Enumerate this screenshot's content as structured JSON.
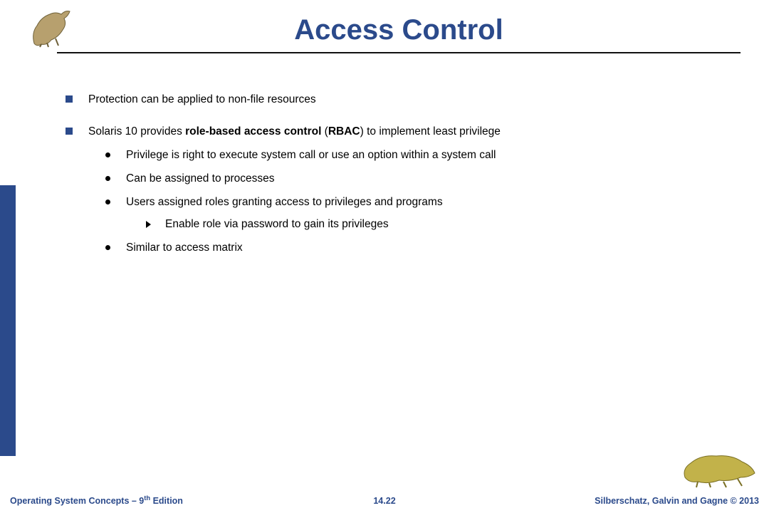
{
  "title": "Access Control",
  "bullets": {
    "b1": "Protection can be applied to non-file resources",
    "b2_pre": "Solaris 10 provides ",
    "b2_bold1": "role-based access control",
    "b2_mid": " (",
    "b2_bold2": "RBAC",
    "b2_post": ") to implement least privilege",
    "s1_pre": "",
    "s1_em": "Privilege",
    "s1_post": " is right to execute system call or use an option within a system call",
    "s2": "Can be assigned to processes",
    "s3_pre": "Users assigned ",
    "s3_em": "roles",
    "s3_post": " granting access to privileges and programs",
    "s3a": "Enable role via password to gain its privileges",
    "s4": "Similar to access matrix"
  },
  "footer": {
    "left_pre": "Operating System Concepts – 9",
    "left_sup": "th",
    "left_post": " Edition",
    "center": "14.22",
    "right": "Silberschatz, Galvin and Gagne © 2013"
  }
}
